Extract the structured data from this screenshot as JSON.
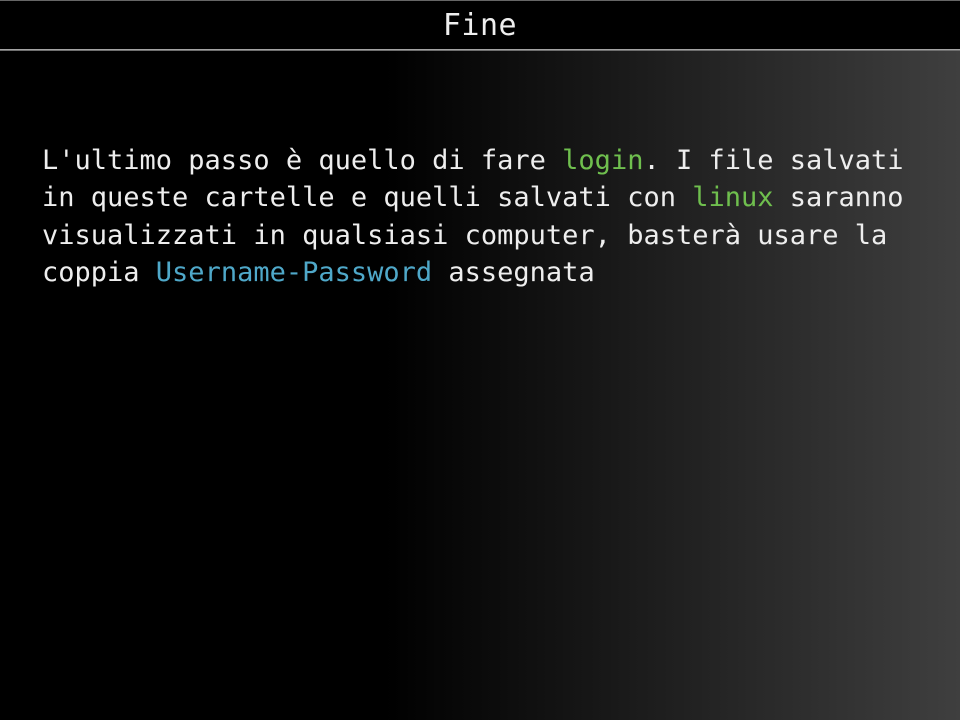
{
  "slide": {
    "title": "Fine",
    "body": {
      "part1": "L'ultimo passo è quello di fare ",
      "login": "login",
      "part2": ". I file salvati in queste cartelle e quelli salvati con ",
      "linux": "linux",
      "part3": " saranno visualizzati in qualsiasi computer, basterà usare la coppia ",
      "userpass": "Username-Password",
      "part4": " assegnata"
    }
  }
}
